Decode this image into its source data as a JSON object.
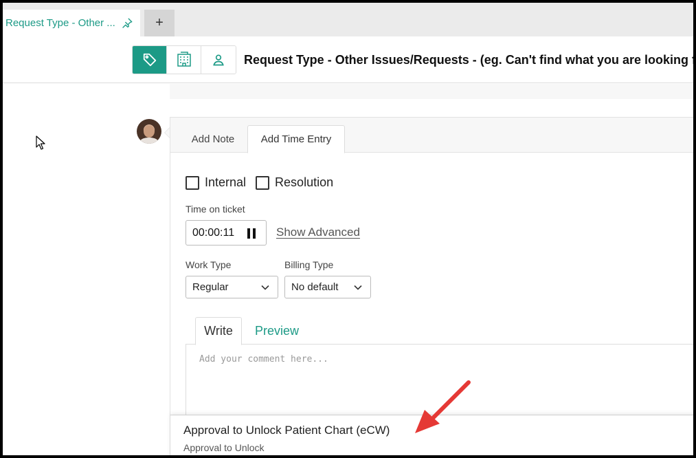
{
  "tabs": {
    "active_title": "Request Type - Other ...",
    "new_tab_label": "+"
  },
  "header": {
    "title": "Request Type - Other Issues/Requests - (eg. Can't find what you are looking for? Us",
    "segments": [
      "tag-icon",
      "building-icon",
      "user-icon"
    ]
  },
  "panel": {
    "tabs": [
      "Add Note",
      "Add Time Entry"
    ],
    "active_tab": "Add Time Entry",
    "checkbox_internal": "Internal",
    "checkbox_resolution": "Resolution",
    "time_label": "Time on ticket",
    "time_value": "00:00:11",
    "show_advanced": "Show Advanced",
    "work_type_label": "Work Type",
    "work_type_value": "Regular",
    "billing_type_label": "Billing Type",
    "billing_type_value": "No default",
    "editor_tabs": [
      "Write",
      "Preview"
    ],
    "editor_placeholder": "Add your comment here..."
  },
  "dropdown": {
    "title": "Approval to Unlock Patient Chart (eCW)",
    "subtitle": "Approval to Unlock"
  },
  "colors": {
    "accent": "#1c9a86",
    "annotation_arrow": "#e53935"
  }
}
